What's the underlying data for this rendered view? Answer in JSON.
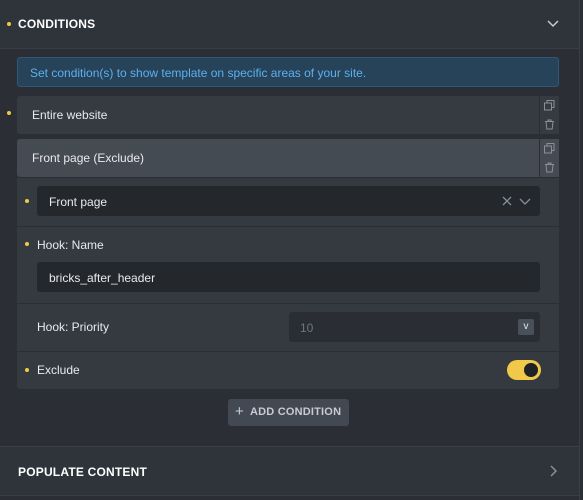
{
  "conditions_section": {
    "title": "CONDITIONS",
    "info_text": "Set condition(s) to show template on specific areas of your site.",
    "rows": [
      {
        "label": "Entire website"
      },
      {
        "label": "Front page (Exclude)"
      }
    ],
    "detail": {
      "select_value": "Front page",
      "hook_name_label": "Hook: Name",
      "hook_name_value": "bricks_after_header",
      "hook_priority_label": "Hook: Priority",
      "hook_priority_placeholder": "10",
      "hook_priority_stepper": "v",
      "exclude_label": "Exclude",
      "exclude_on": true
    },
    "add_label": "ADD CONDITION",
    "add_icon": "+"
  },
  "populate_section": {
    "title": "POPULATE CONTENT"
  },
  "colors": {
    "accent": "#f0c94a",
    "info_text": "#5cb0ee",
    "info_bg": "#26435a"
  }
}
